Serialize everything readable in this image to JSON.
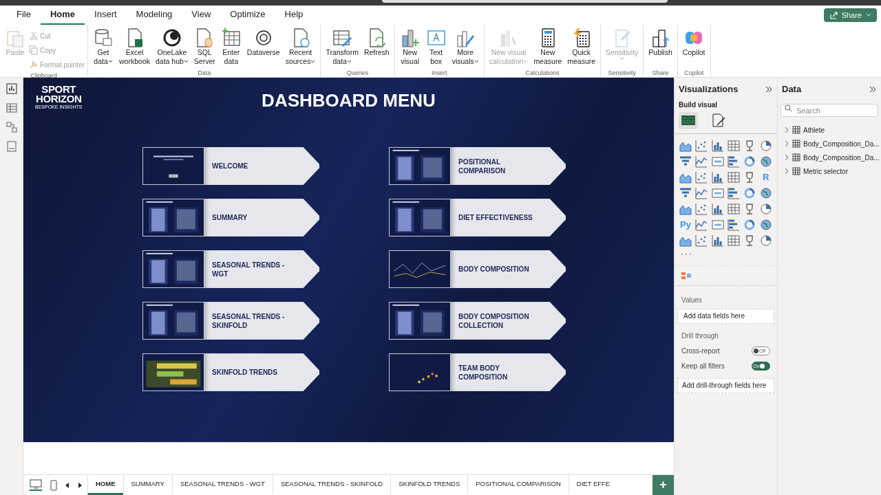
{
  "menu": {
    "tabs": [
      {
        "label": "File",
        "selected": false
      },
      {
        "label": "Home",
        "selected": true
      },
      {
        "label": "Insert",
        "selected": false
      },
      {
        "label": "Modeling",
        "selected": false
      },
      {
        "label": "View",
        "selected": false
      },
      {
        "label": "Optimize",
        "selected": false
      },
      {
        "label": "Help",
        "selected": false
      }
    ],
    "share_button": "Share"
  },
  "ribbon": {
    "groups": [
      {
        "label": "Clipboard",
        "items": [
          {
            "kind": "large",
            "lines": [
              "Paste"
            ],
            "disabled": true
          },
          {
            "kind": "small",
            "lines": [
              "Cut"
            ],
            "disabled": true
          },
          {
            "kind": "small",
            "lines": [
              "Copy"
            ],
            "disabled": true
          },
          {
            "kind": "small",
            "lines": [
              "Format painter"
            ],
            "disabled": true
          }
        ]
      },
      {
        "label": "Data",
        "items": [
          {
            "kind": "large",
            "lines": [
              "Get",
              "data"
            ],
            "disabled": false,
            "dropdown": true
          },
          {
            "kind": "large",
            "lines": [
              "Excel",
              "workbook"
            ],
            "disabled": false
          },
          {
            "kind": "large",
            "lines": [
              "OneLake",
              "data hub"
            ],
            "disabled": false,
            "dropdown": true
          },
          {
            "kind": "large",
            "lines": [
              "SQL",
              "Server"
            ],
            "disabled": false
          },
          {
            "kind": "large",
            "lines": [
              "Enter",
              "data"
            ],
            "disabled": false
          },
          {
            "kind": "large",
            "lines": [
              "Dataverse"
            ],
            "disabled": false
          },
          {
            "kind": "large",
            "lines": [
              "Recent",
              "sources"
            ],
            "disabled": false,
            "dropdown": true
          }
        ]
      },
      {
        "label": "Queries",
        "items": [
          {
            "kind": "large",
            "lines": [
              "Transform",
              "data"
            ],
            "disabled": false,
            "dropdown": true
          },
          {
            "kind": "large",
            "lines": [
              "Refresh"
            ],
            "disabled": false
          }
        ]
      },
      {
        "label": "Insert",
        "items": [
          {
            "kind": "large",
            "lines": [
              "New",
              "visual"
            ],
            "disabled": false
          },
          {
            "kind": "large",
            "lines": [
              "Text",
              "box"
            ],
            "disabled": false
          },
          {
            "kind": "large",
            "lines": [
              "More",
              "visuals"
            ],
            "disabled": false,
            "dropdown": true
          }
        ]
      },
      {
        "label": "Calculations",
        "items": [
          {
            "kind": "large",
            "lines": [
              "New visual",
              "calculation"
            ],
            "disabled": true,
            "dropdown": true
          },
          {
            "kind": "large",
            "lines": [
              "New",
              "measure"
            ],
            "disabled": false
          },
          {
            "kind": "large",
            "lines": [
              "Quick",
              "measure"
            ],
            "disabled": false
          }
        ]
      },
      {
        "label": "Sensitivity",
        "items": [
          {
            "kind": "large",
            "lines": [
              "Sensitivity"
            ],
            "disabled": true,
            "dropdown": true
          }
        ]
      },
      {
        "label": "Share",
        "items": [
          {
            "kind": "large",
            "lines": [
              "Publish"
            ],
            "disabled": false
          }
        ]
      },
      {
        "label": "Copilot",
        "items": [
          {
            "kind": "large",
            "lines": [
              "Copilot"
            ],
            "disabled": false
          }
        ]
      }
    ]
  },
  "report": {
    "logo": {
      "line1": "SPORT",
      "line2": "HORIZON",
      "tagline": "BESPOKE INSIGHTS"
    },
    "title": "DASHBOARD MENU",
    "columns": [
      [
        {
          "label": "WELCOME"
        },
        {
          "label": "SUMMARY"
        },
        {
          "label": "SEASONAL TRENDS - WGT"
        },
        {
          "label": "SEASONAL TRENDS - SKINFOLD"
        },
        {
          "label": "SKINFOLD TRENDS"
        }
      ],
      [
        {
          "label": "POSITIONAL COMPARISON"
        },
        {
          "label": "DIET EFFECTIVENESS"
        },
        {
          "label": "BODY COMPOSITION"
        },
        {
          "label": "BODY COMPOSITION COLLECTION"
        },
        {
          "label": "TEAM BODY COMPOSITION"
        }
      ]
    ]
  },
  "visualizations": {
    "title": "Visualizations",
    "build_visual": "Build visual",
    "build_tabs": [
      {
        "selected": true
      },
      {
        "selected": false
      }
    ],
    "gallery_text_icons": [
      "R",
      "Py"
    ],
    "more": "···",
    "values_label": "Values",
    "values_placeholder": "Add data fields here",
    "drill_through": "Drill through",
    "toggles": [
      {
        "label": "Cross-report",
        "on": false,
        "text": "Off"
      },
      {
        "label": "Keep all filters",
        "on": true,
        "text": "On"
      }
    ],
    "drill_placeholder": "Add drill-through fields here"
  },
  "data": {
    "title": "Data",
    "search_placeholder": "Search",
    "tables": [
      "Athlete",
      "Body_Composition_Da...",
      "Body_Composition_Da...",
      "Metric selector"
    ]
  },
  "page_tabs": [
    {
      "label": "HOME",
      "selected": true
    },
    {
      "label": "SUMMARY",
      "selected": false
    },
    {
      "label": "SEASONAL TRENDS - WGT",
      "selected": false
    },
    {
      "label": "SEASONAL TRENDS - SKINFOLD",
      "selected": false
    },
    {
      "label": "SKINFOLD TRENDS",
      "selected": false
    },
    {
      "label": "POSITIONAL COMPARISON",
      "selected": false
    },
    {
      "label": "DIET EFFE",
      "selected": false
    }
  ],
  "add_page": "+"
}
